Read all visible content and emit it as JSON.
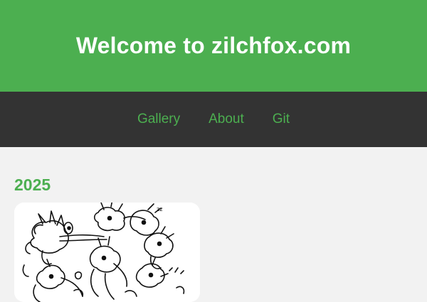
{
  "header": {
    "title": "Welcome to zilchfox.com",
    "background": "#4caf50"
  },
  "nav": {
    "background": "#333333",
    "link_color": "#4caf50",
    "items": [
      {
        "label": "Gallery"
      },
      {
        "label": "About"
      },
      {
        "label": "Git"
      }
    ]
  },
  "main": {
    "sections": [
      {
        "year": "2025",
        "thumbnails": [
          {
            "icon": "sketch-artwork"
          }
        ]
      }
    ]
  }
}
